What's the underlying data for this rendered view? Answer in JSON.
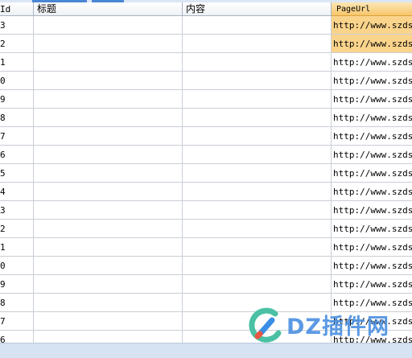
{
  "columns": [
    {
      "key": "id",
      "label": "Id"
    },
    {
      "key": "title",
      "label": "标题"
    },
    {
      "key": "content",
      "label": "内容"
    },
    {
      "key": "pageurl",
      "label": "PageUrl"
    }
  ],
  "rows": [
    {
      "id": "3",
      "title": "",
      "content": "",
      "pageurl": "http://www.szdsto"
    },
    {
      "id": "2",
      "title": "",
      "content": "",
      "pageurl": "http://www.szdsto"
    },
    {
      "id": "1",
      "title": "",
      "content": "",
      "pageurl": "http://www.szdsto"
    },
    {
      "id": "0",
      "title": "",
      "content": "",
      "pageurl": "http://www.szdsto"
    },
    {
      "id": "9",
      "title": "",
      "content": "",
      "pageurl": "http://www.szdsto"
    },
    {
      "id": "8",
      "title": "",
      "content": "",
      "pageurl": "http://www.szdsto"
    },
    {
      "id": "7",
      "title": "",
      "content": "",
      "pageurl": "http://www.szdsto"
    },
    {
      "id": "6",
      "title": "",
      "content": "",
      "pageurl": "http://www.szdsto"
    },
    {
      "id": "5",
      "title": "",
      "content": "",
      "pageurl": "http://www.szdsto"
    },
    {
      "id": "4",
      "title": "",
      "content": "",
      "pageurl": "http://www.szdsto"
    },
    {
      "id": "3",
      "title": "",
      "content": "",
      "pageurl": "http://www.szdsto"
    },
    {
      "id": "2",
      "title": "",
      "content": "",
      "pageurl": "http://www.szdsto"
    },
    {
      "id": "1",
      "title": "",
      "content": "",
      "pageurl": "http://www.szdsto"
    },
    {
      "id": "0",
      "title": "",
      "content": "",
      "pageurl": "http://www.szdsto"
    },
    {
      "id": "9",
      "title": "",
      "content": "",
      "pageurl": "http://www.szdsto"
    },
    {
      "id": "8",
      "title": "",
      "content": "",
      "pageurl": "http://www.szdsto"
    },
    {
      "id": "7",
      "title": "",
      "content": "",
      "pageurl": "http://www.szdsto"
    },
    {
      "id": "6",
      "title": "",
      "content": "",
      "pageurl": "http://www.szdsto"
    }
  ],
  "selected_rows": [
    0,
    1
  ],
  "watermark": {
    "text": "DZ插件网",
    "icon": "dz-logo-icon"
  },
  "colors": {
    "selected_cell": "#fbd48c",
    "selected_header": "#f7c66c",
    "grid_line": "#c9ced6",
    "scrollbar": "#d6e3f3"
  }
}
